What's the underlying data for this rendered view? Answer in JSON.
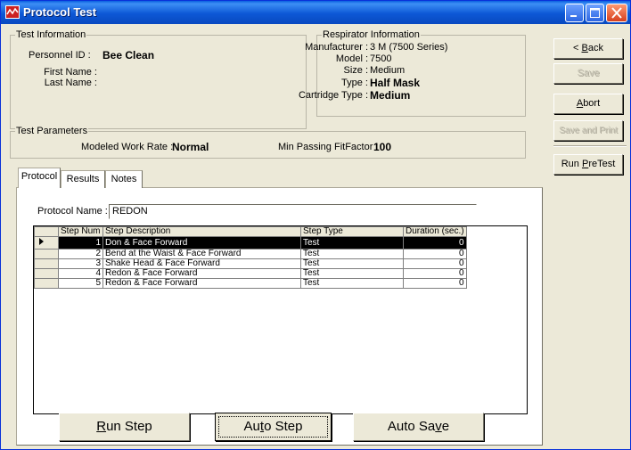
{
  "window": {
    "title": "Protocol Test",
    "title_bar_color": "#0a5fe0",
    "close_button_color": "#d6401f"
  },
  "test_information": {
    "group_label": "Test Information",
    "personnel_id_label": "Personnel ID :",
    "personnel_id_value": "Bee Clean",
    "first_name_label": "First Name :",
    "last_name_label": "Last Name :"
  },
  "respirator_information": {
    "group_label": "Respirator Information",
    "manufacturer_label": "Manufacturer :",
    "manufacturer_value": "3 M (7500 Series)",
    "model_label": "Model :",
    "model_value": "7500",
    "size_label": "Size :",
    "size_value": "Medium",
    "type_label": "Type :",
    "type_value": "Half Mask",
    "cartridge_label": "Cartridge Type :",
    "cartridge_value": "Medium"
  },
  "test_parameters": {
    "group_label": "Test Parameters",
    "work_rate_label": "Modeled Work Rate :",
    "work_rate_value": "Normal",
    "min_fit_label": "Min Passing FitFactor :",
    "min_fit_value": "100"
  },
  "side_buttons": {
    "back_pre": "< ",
    "back_ul": "B",
    "back_post": "ack",
    "save": "Save",
    "abort_ul": "A",
    "abort_post": "bort",
    "save_and_print": "Save and Print",
    "run_pretest_pre": "Run ",
    "run_pretest_ul": "P",
    "run_pretest_post": "reTest"
  },
  "tabs": [
    "Protocol",
    "Results",
    "Notes"
  ],
  "protocol": {
    "name_label": "Protocol Name :",
    "name_value": "REDON",
    "columns": [
      "Step Num",
      "Step Description",
      "Step Type",
      "Duration (sec.)"
    ],
    "rows": [
      {
        "num": "1",
        "desc": "Don & Face Forward",
        "type": "Test",
        "duration": "0",
        "selected": true
      },
      {
        "num": "2",
        "desc": "Bend at the Waist & Face Forward",
        "type": "Test",
        "duration": "0"
      },
      {
        "num": "3",
        "desc": "Shake Head & Face Forward",
        "type": "Test",
        "duration": "0"
      },
      {
        "num": "4",
        "desc": "Redon & Face Forward",
        "type": "Test",
        "duration": "0"
      },
      {
        "num": "5",
        "desc": "Redon & Face Forward",
        "type": "Test",
        "duration": "0"
      }
    ]
  },
  "bottom_buttons": {
    "run_step_ul": "R",
    "run_step_post": "un Step",
    "auto_step_pre": "Au",
    "auto_step_ul": "t",
    "auto_step_post": "o Step",
    "auto_save_pre": "Auto Sa",
    "auto_save_ul": "v",
    "auto_save_post": "e"
  }
}
